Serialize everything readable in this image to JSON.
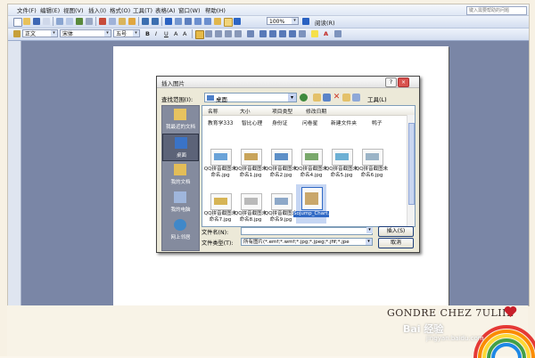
{
  "menu": [
    "文件(F)",
    "编辑(E)",
    "视图(V)",
    "插入(I)",
    "格式(O)",
    "工具(T)",
    "表格(A)",
    "窗口(W)",
    "帮助(H)"
  ],
  "help_box": "键入需要帮助的问题",
  "toolbar1": {
    "zoom": "100%",
    "read_mode": "阅读(R)"
  },
  "toolbar2": {
    "style": "正文",
    "font": "宋体",
    "size": "五号"
  },
  "dialog": {
    "title": "插入图片",
    "lookin_label": "查找范围(I):",
    "lookin_value": "桌面",
    "tools_menu": "工具(L)",
    "places": [
      "我最近的文档",
      "桌面",
      "我的文档",
      "我的电脑",
      "网上邻居"
    ],
    "column_headers": [
      "名称",
      "大小",
      "项目类型",
      "修改日期"
    ],
    "row_items": [
      "教育学333",
      "智比心理",
      "身份证",
      "问卷星",
      "新建文件夹",
      "鸭子"
    ],
    "files": [
      {
        "name": "QQ拼音截图未命名.jpg",
        "color": "#6aa3d8"
      },
      {
        "name": "QQ拼音截图未命名1.jpg",
        "color": "#c8a45a"
      },
      {
        "name": "QQ拼音截图未命名2.jpg",
        "color": "#5d8fc7"
      },
      {
        "name": "QQ拼音截图未命名4.jpg",
        "color": "#79a86b"
      },
      {
        "name": "QQ拼音截图未命名5.jpg",
        "color": "#6db0d4"
      },
      {
        "name": "QQ拼音截图未命名6.jpg",
        "color": "#9bb4c7"
      },
      {
        "name": "QQ拼音截图未命名7.jpg",
        "color": "#d6b455"
      },
      {
        "name": "QQ拼音截图未命名8.jpg",
        "color": "#b9b9b9"
      },
      {
        "name": "QQ拼音截图未命名9.jpg",
        "color": "#8da8c8"
      },
      {
        "name": "Sojump_Chart.jpg",
        "color": "#c9a76b"
      }
    ],
    "filename_label": "文件名(N):",
    "filename_value": "",
    "filetype_label": "文件类型(T):",
    "filetype_value": "所有图片(*.emf;*.wmf;*.jpg;*.jpeg;*.jfif;*.jpe",
    "insert_button": "插入(S)",
    "cancel_button": "取消"
  },
  "watermark": {
    "signature": "GONDRE CHEZ 7ULIIE",
    "baidu": "Bai 经验",
    "url": "jingyan.baidu.com"
  }
}
